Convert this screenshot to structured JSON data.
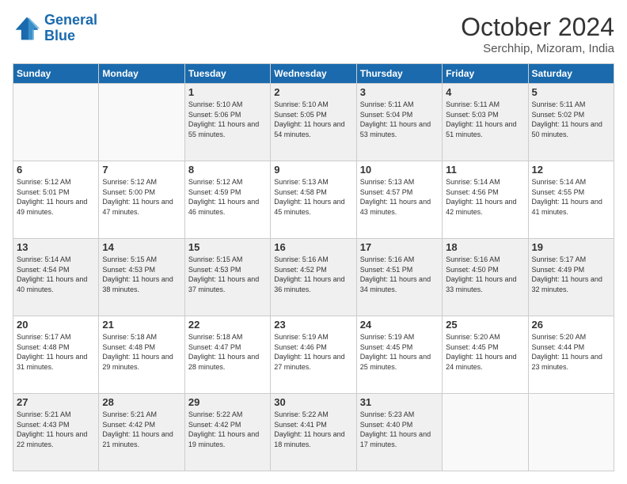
{
  "logo": {
    "line1": "General",
    "line2": "Blue"
  },
  "title": "October 2024",
  "location": "Serchhip, Mizoram, India",
  "headers": [
    "Sunday",
    "Monday",
    "Tuesday",
    "Wednesday",
    "Thursday",
    "Friday",
    "Saturday"
  ],
  "weeks": [
    [
      {
        "day": "",
        "sunrise": "",
        "sunset": "",
        "daylight": ""
      },
      {
        "day": "",
        "sunrise": "",
        "sunset": "",
        "daylight": ""
      },
      {
        "day": "1",
        "sunrise": "Sunrise: 5:10 AM",
        "sunset": "Sunset: 5:06 PM",
        "daylight": "Daylight: 11 hours and 55 minutes."
      },
      {
        "day": "2",
        "sunrise": "Sunrise: 5:10 AM",
        "sunset": "Sunset: 5:05 PM",
        "daylight": "Daylight: 11 hours and 54 minutes."
      },
      {
        "day": "3",
        "sunrise": "Sunrise: 5:11 AM",
        "sunset": "Sunset: 5:04 PM",
        "daylight": "Daylight: 11 hours and 53 minutes."
      },
      {
        "day": "4",
        "sunrise": "Sunrise: 5:11 AM",
        "sunset": "Sunset: 5:03 PM",
        "daylight": "Daylight: 11 hours and 51 minutes."
      },
      {
        "day": "5",
        "sunrise": "Sunrise: 5:11 AM",
        "sunset": "Sunset: 5:02 PM",
        "daylight": "Daylight: 11 hours and 50 minutes."
      }
    ],
    [
      {
        "day": "6",
        "sunrise": "Sunrise: 5:12 AM",
        "sunset": "Sunset: 5:01 PM",
        "daylight": "Daylight: 11 hours and 49 minutes."
      },
      {
        "day": "7",
        "sunrise": "Sunrise: 5:12 AM",
        "sunset": "Sunset: 5:00 PM",
        "daylight": "Daylight: 11 hours and 47 minutes."
      },
      {
        "day": "8",
        "sunrise": "Sunrise: 5:12 AM",
        "sunset": "Sunset: 4:59 PM",
        "daylight": "Daylight: 11 hours and 46 minutes."
      },
      {
        "day": "9",
        "sunrise": "Sunrise: 5:13 AM",
        "sunset": "Sunset: 4:58 PM",
        "daylight": "Daylight: 11 hours and 45 minutes."
      },
      {
        "day": "10",
        "sunrise": "Sunrise: 5:13 AM",
        "sunset": "Sunset: 4:57 PM",
        "daylight": "Daylight: 11 hours and 43 minutes."
      },
      {
        "day": "11",
        "sunrise": "Sunrise: 5:14 AM",
        "sunset": "Sunset: 4:56 PM",
        "daylight": "Daylight: 11 hours and 42 minutes."
      },
      {
        "day": "12",
        "sunrise": "Sunrise: 5:14 AM",
        "sunset": "Sunset: 4:55 PM",
        "daylight": "Daylight: 11 hours and 41 minutes."
      }
    ],
    [
      {
        "day": "13",
        "sunrise": "Sunrise: 5:14 AM",
        "sunset": "Sunset: 4:54 PM",
        "daylight": "Daylight: 11 hours and 40 minutes."
      },
      {
        "day": "14",
        "sunrise": "Sunrise: 5:15 AM",
        "sunset": "Sunset: 4:53 PM",
        "daylight": "Daylight: 11 hours and 38 minutes."
      },
      {
        "day": "15",
        "sunrise": "Sunrise: 5:15 AM",
        "sunset": "Sunset: 4:53 PM",
        "daylight": "Daylight: 11 hours and 37 minutes."
      },
      {
        "day": "16",
        "sunrise": "Sunrise: 5:16 AM",
        "sunset": "Sunset: 4:52 PM",
        "daylight": "Daylight: 11 hours and 36 minutes."
      },
      {
        "day": "17",
        "sunrise": "Sunrise: 5:16 AM",
        "sunset": "Sunset: 4:51 PM",
        "daylight": "Daylight: 11 hours and 34 minutes."
      },
      {
        "day": "18",
        "sunrise": "Sunrise: 5:16 AM",
        "sunset": "Sunset: 4:50 PM",
        "daylight": "Daylight: 11 hours and 33 minutes."
      },
      {
        "day": "19",
        "sunrise": "Sunrise: 5:17 AM",
        "sunset": "Sunset: 4:49 PM",
        "daylight": "Daylight: 11 hours and 32 minutes."
      }
    ],
    [
      {
        "day": "20",
        "sunrise": "Sunrise: 5:17 AM",
        "sunset": "Sunset: 4:48 PM",
        "daylight": "Daylight: 11 hours and 31 minutes."
      },
      {
        "day": "21",
        "sunrise": "Sunrise: 5:18 AM",
        "sunset": "Sunset: 4:48 PM",
        "daylight": "Daylight: 11 hours and 29 minutes."
      },
      {
        "day": "22",
        "sunrise": "Sunrise: 5:18 AM",
        "sunset": "Sunset: 4:47 PM",
        "daylight": "Daylight: 11 hours and 28 minutes."
      },
      {
        "day": "23",
        "sunrise": "Sunrise: 5:19 AM",
        "sunset": "Sunset: 4:46 PM",
        "daylight": "Daylight: 11 hours and 27 minutes."
      },
      {
        "day": "24",
        "sunrise": "Sunrise: 5:19 AM",
        "sunset": "Sunset: 4:45 PM",
        "daylight": "Daylight: 11 hours and 25 minutes."
      },
      {
        "day": "25",
        "sunrise": "Sunrise: 5:20 AM",
        "sunset": "Sunset: 4:45 PM",
        "daylight": "Daylight: 11 hours and 24 minutes."
      },
      {
        "day": "26",
        "sunrise": "Sunrise: 5:20 AM",
        "sunset": "Sunset: 4:44 PM",
        "daylight": "Daylight: 11 hours and 23 minutes."
      }
    ],
    [
      {
        "day": "27",
        "sunrise": "Sunrise: 5:21 AM",
        "sunset": "Sunset: 4:43 PM",
        "daylight": "Daylight: 11 hours and 22 minutes."
      },
      {
        "day": "28",
        "sunrise": "Sunrise: 5:21 AM",
        "sunset": "Sunset: 4:42 PM",
        "daylight": "Daylight: 11 hours and 21 minutes."
      },
      {
        "day": "29",
        "sunrise": "Sunrise: 5:22 AM",
        "sunset": "Sunset: 4:42 PM",
        "daylight": "Daylight: 11 hours and 19 minutes."
      },
      {
        "day": "30",
        "sunrise": "Sunrise: 5:22 AM",
        "sunset": "Sunset: 4:41 PM",
        "daylight": "Daylight: 11 hours and 18 minutes."
      },
      {
        "day": "31",
        "sunrise": "Sunrise: 5:23 AM",
        "sunset": "Sunset: 4:40 PM",
        "daylight": "Daylight: 11 hours and 17 minutes."
      },
      {
        "day": "",
        "sunrise": "",
        "sunset": "",
        "daylight": ""
      },
      {
        "day": "",
        "sunrise": "",
        "sunset": "",
        "daylight": ""
      }
    ]
  ]
}
